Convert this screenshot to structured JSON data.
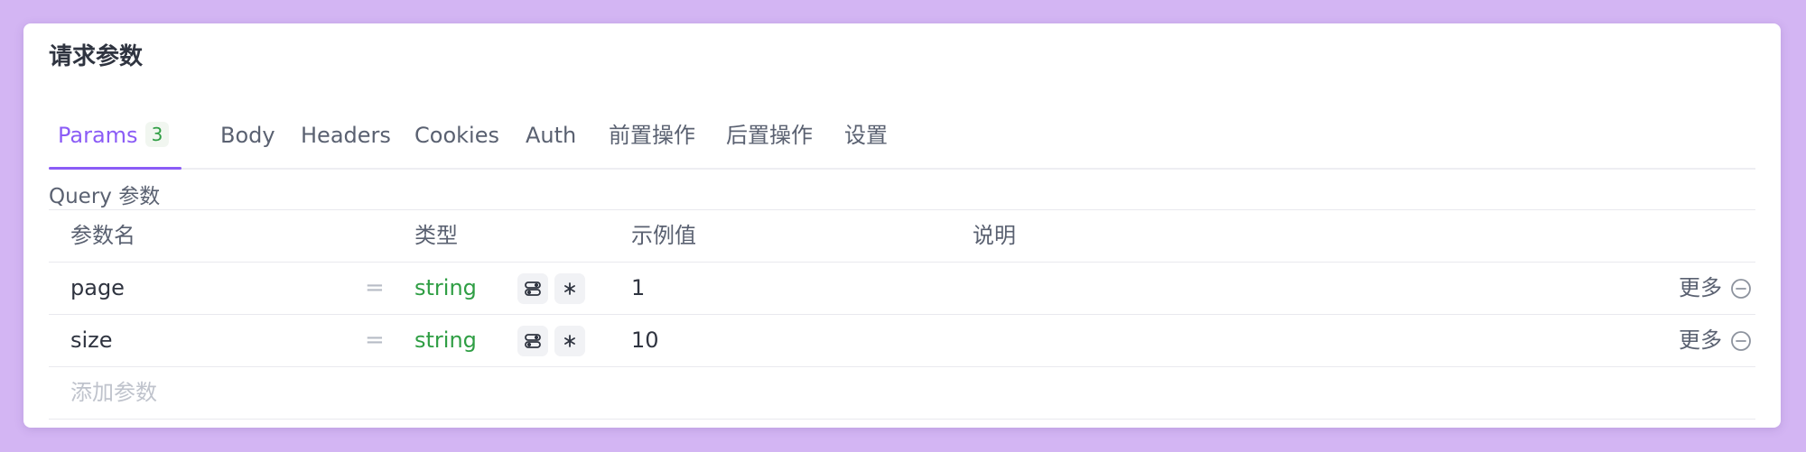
{
  "panel": {
    "title": "请求参数",
    "tabs": [
      {
        "label": "Params",
        "badge": "3"
      },
      {
        "label": "Body"
      },
      {
        "label": "Headers"
      },
      {
        "label": "Cookies"
      },
      {
        "label": "Auth"
      },
      {
        "label": "前置操作"
      },
      {
        "label": "后置操作"
      },
      {
        "label": "设置"
      }
    ],
    "section_label": "Query 参数",
    "columns": [
      "参数名",
      "类型",
      "示例值",
      "说明"
    ],
    "rows": [
      {
        "name": "page",
        "equals": "=",
        "type": "string",
        "value": "1",
        "description": "",
        "more": "更多"
      },
      {
        "name": "size",
        "equals": "=",
        "type": "string",
        "value": "10",
        "description": "",
        "more": "更多"
      }
    ],
    "add_placeholder": "添加参数",
    "icons": {
      "link": "link-icon",
      "required": "asterisk-icon",
      "remove": "minus-circle-icon"
    },
    "colors": {
      "accent": "#8b5cf6",
      "type": "#2f9e44",
      "background": "#d3b5f3"
    }
  }
}
